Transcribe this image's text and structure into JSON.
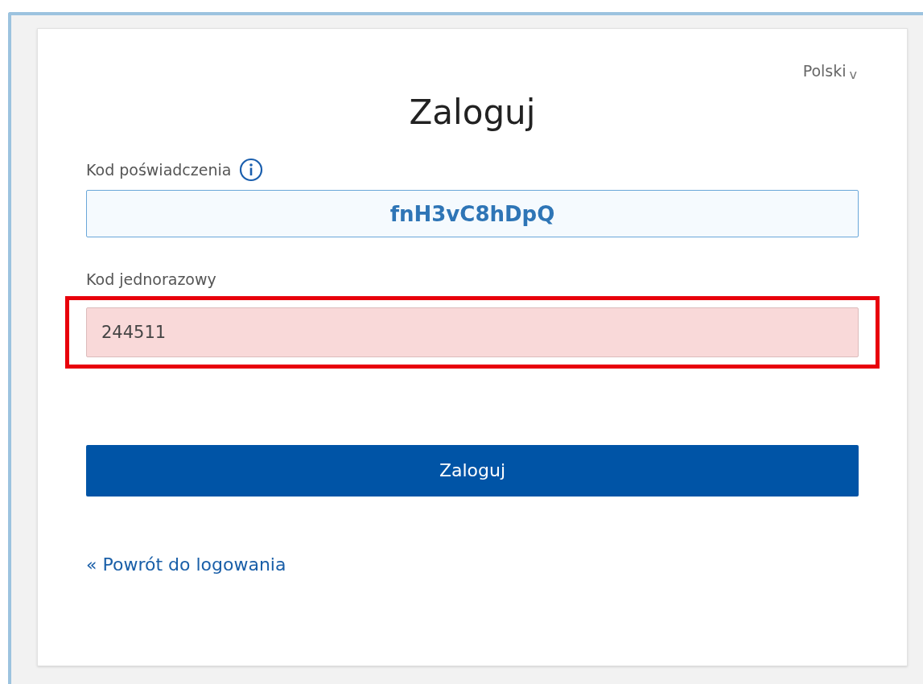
{
  "language": {
    "label": "Polski",
    "caret": "v"
  },
  "title": "Zaloguj",
  "fields": [
    {
      "label": "Kod poświadczenia",
      "value": "fnH3vC8hDpQ",
      "kind": "readonly",
      "info": true,
      "highlighted": false
    },
    {
      "label": "Kod jednorazowy",
      "value": "244511",
      "kind": "input",
      "info": false,
      "highlighted": true
    }
  ],
  "submit": "Zaloguj",
  "back_link": "« Powrót do logowania"
}
